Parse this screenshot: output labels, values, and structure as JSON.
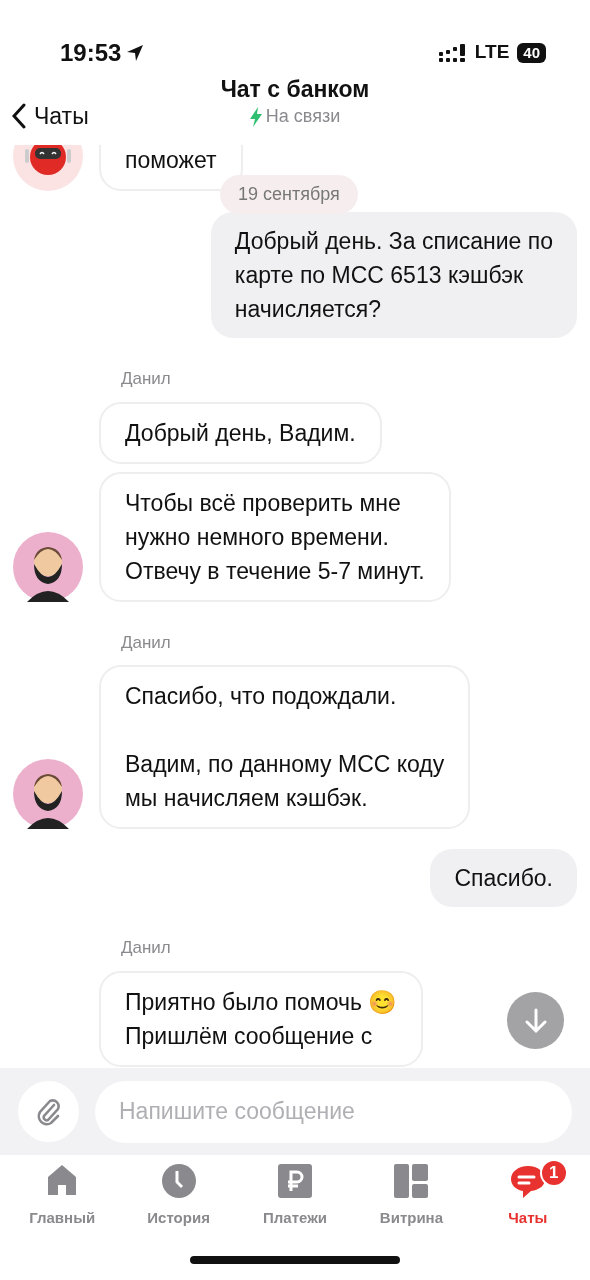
{
  "status_bar": {
    "time": "19:53",
    "network": "LTE",
    "battery": "40"
  },
  "header": {
    "back_label": "Чаты",
    "title": "Чат с банком",
    "status": "На связи"
  },
  "date_pill": "19 сентября",
  "messages": [
    {
      "kind": "bot",
      "avatar": true,
      "bubbles": [
        "поможет"
      ]
    },
    {
      "kind": "outgoing",
      "text": "Добрый день. За списание по\nкарте по МСС 6513 кэшбэк\nначисляется?"
    },
    {
      "kind": "agent",
      "author": "Данил",
      "avatar": true,
      "bubbles": [
        "Добрый день, Вадим.",
        "Чтобы всё проверить мне\nнужно немного времени.\nОтвечу в течение 5-7 минут."
      ]
    },
    {
      "kind": "agent",
      "author": "Данил",
      "avatar": true,
      "bubbles": [
        "Спасибо, что подождали.\n\nВадим, по данному МСС коду\nмы начисляем кэшбэк."
      ]
    },
    {
      "kind": "outgoing",
      "text": "Спасибо."
    },
    {
      "kind": "agent",
      "author": "Данил",
      "avatar": false,
      "bubbles": [
        "Приятно было помочь 😊\nПришлём сообщение с"
      ]
    }
  ],
  "composer": {
    "placeholder": "Напишите сообщение"
  },
  "tabs": [
    {
      "label": "Главный",
      "selected": false
    },
    {
      "label": "История",
      "selected": false
    },
    {
      "label": "Платежи",
      "selected": false
    },
    {
      "label": "Витрина",
      "selected": false
    },
    {
      "label": "Чаты",
      "selected": true,
      "badge": "1"
    }
  ]
}
